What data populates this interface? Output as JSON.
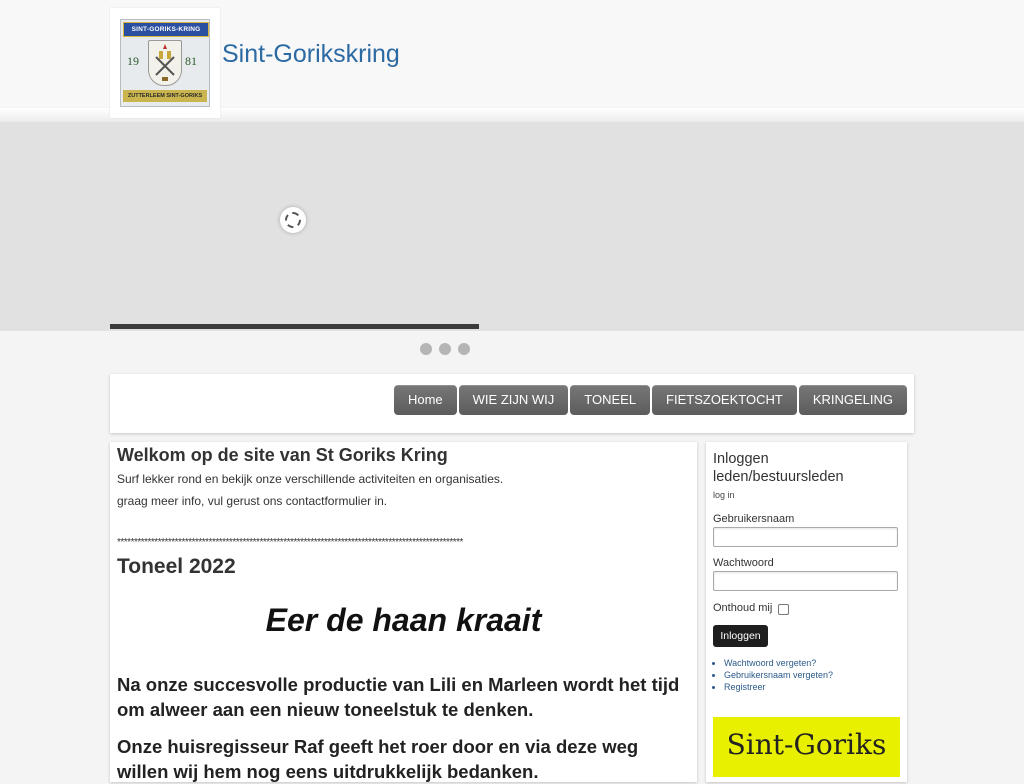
{
  "header": {
    "site_title": "Sint-Gorikskring",
    "logo": {
      "top_text": "SINT-GORIKS-KRING",
      "year_left": "19",
      "year_right": "81",
      "bottom_text": "ZUTTERLEEM SINT-GORIKS"
    }
  },
  "slider": {
    "dot_count": 3,
    "progress": 0.36
  },
  "nav": {
    "items": [
      {
        "label": "Home"
      },
      {
        "label": "WIE ZIJN WIJ"
      },
      {
        "label": "TONEEL"
      },
      {
        "label": "FIETSZOEKTOCHT"
      },
      {
        "label": "KRINGELING"
      }
    ]
  },
  "main": {
    "title": "Welkom op de site van St Goriks Kring",
    "intro_1": "Surf lekker rond en bekijk onze verschillende activiteiten en organisaties.",
    "intro_2": "graag meer info, vul gerust ons contactformulier in.",
    "separator": "******************************************************************************************************",
    "section_title": "Toneel 2022",
    "play_title": "Eer de haan kraait",
    "paragraph_1": "Na onze succesvolle productie van Lili en Marleen wordt het tijd om alweer aan een nieuw toneelstuk te denken.",
    "paragraph_2": "Onze huisregisseur Raf geeft het roer door en via deze weg willen wij hem nog eens uitdrukkelijk bedanken."
  },
  "sidebar": {
    "title": "Inloggen leden/bestuursleden",
    "subtitle": "log in",
    "username_label": "Gebruikersnaam",
    "password_label": "Wachtwoord",
    "remember_label": "Onthoud mij",
    "login_button": "Inloggen",
    "links": [
      {
        "label": "Wachtwoord vergeten?"
      },
      {
        "label": "Gebruikersnaam vergeten?"
      },
      {
        "label": "Registreer"
      }
    ],
    "banner_text": "Sint-Goriks"
  }
}
